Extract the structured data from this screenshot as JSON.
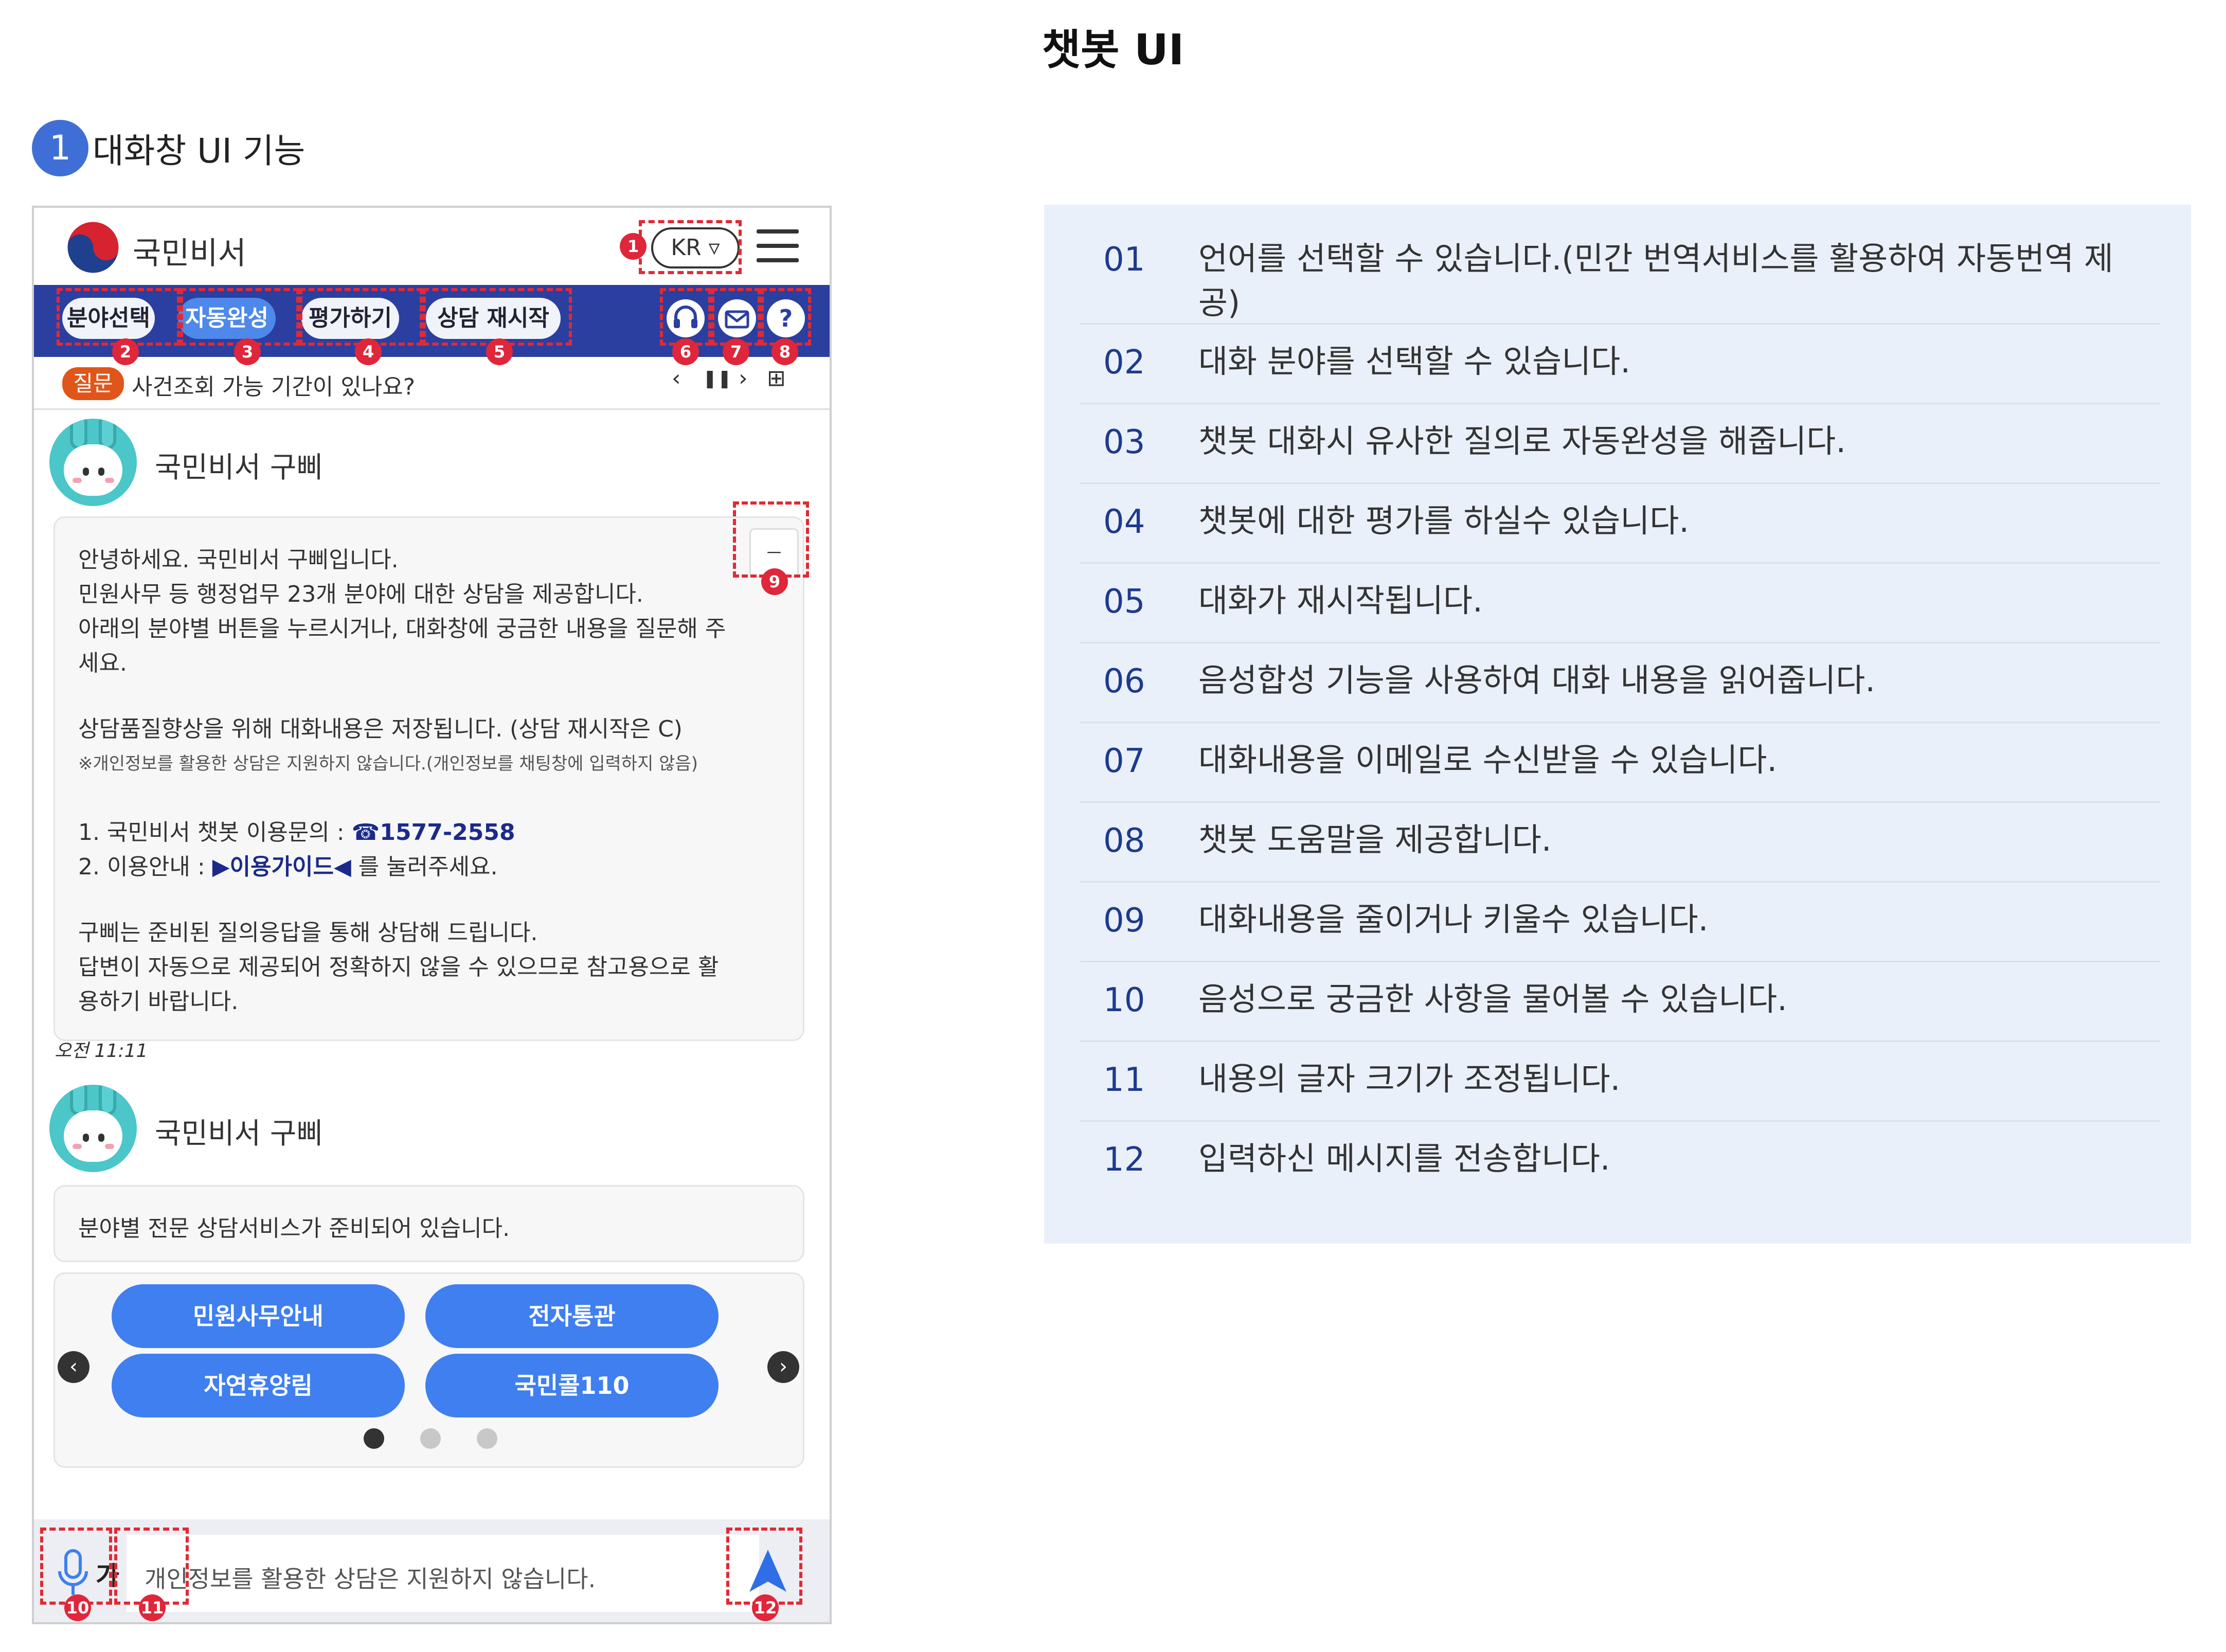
{
  "page_title": "챗봇 UI",
  "section": {
    "number": "1",
    "title": "대화창 UI 기능"
  },
  "phone": {
    "app_name": "국민비서",
    "language_button": "KR",
    "toolbar": {
      "buttons": [
        "분야선택",
        "자동완성",
        "평가하기",
        "상담 재시작"
      ],
      "icons": [
        "headset-icon",
        "mail-icon",
        "help-icon"
      ],
      "help_glyph": "?"
    },
    "question": {
      "tag": "질문",
      "text": "사건조회 가능 기간이 있나요?",
      "controls": [
        "‹",
        "❚❚",
        "›",
        "⊞"
      ]
    },
    "bot_name": "국민비서 구삐",
    "message1": {
      "lines": [
        "안녕하세요. 국민비서 구삐입니다.",
        "민원사무 등 행정업무 23개 분야에 대한 상담을 제공합니다.",
        "아래의 분야별 버튼을 누르시거나, 대화창에 궁금한 내용을 질문해 주",
        "세요.",
        "상담품질향상을 위해 대화내용은 저장됩니다. (상담 재시작은 C)",
        "※개인정보를 활용한 상담은 지원하지 않습니다.(개인정보를 채팅창에 입력하지 않음)",
        "1. 국민비서 챗봇 이용문의 :",
        "☎1577-2558",
        "2. 이용안내 :",
        "▶이용가이드◀",
        "를 눌러주세요.",
        "구삐는 준비된 질의응답을 통해 상담해 드립니다.",
        "답변이 자동으로 제공되어 정확하지 않을 수 있으므로 참고용으로 활",
        "용하기 바랍니다."
      ],
      "collapse_glyph": "━━━"
    },
    "timestamp": "오전 11:11",
    "message2": {
      "text": "분야별 전문 상담서비스가 준비되어 있습니다."
    },
    "service_buttons": [
      "민원사무안내",
      "전자통관",
      "자연휴양림",
      "국민콜110"
    ],
    "carousel_prev": "‹",
    "carousel_next": "›",
    "font_size_button": "가",
    "input_placeholder": "개인정보를 활용한 상담은 지원하지 않습니다."
  },
  "callout_numbers": [
    "1",
    "2",
    "3",
    "4",
    "5",
    "6",
    "7",
    "8",
    "9",
    "10",
    "11",
    "12"
  ],
  "descriptions": [
    {
      "num": "01",
      "text": "언어를 선택할 수 있습니다.(민간 번역서비스를 활용하여 자동번역 제공)"
    },
    {
      "num": "02",
      "text": "대화 분야를 선택할 수 있습니다."
    },
    {
      "num": "03",
      "text": "챗봇 대화시 유사한 질의로 자동완성을 해줍니다."
    },
    {
      "num": "04",
      "text": "챗봇에 대한 평가를 하실수 있습니다."
    },
    {
      "num": "05",
      "text": "대화가 재시작됩니다."
    },
    {
      "num": "06",
      "text": "음성합성 기능을 사용하여 대화 내용을 읽어줍니다."
    },
    {
      "num": "07",
      "text": "대화내용을 이메일로 수신받을 수 있습니다."
    },
    {
      "num": "08",
      "text": "챗봇 도움말을 제공합니다."
    },
    {
      "num": "09",
      "text": "대화내용을 줄이거나 키울수 있습니다."
    },
    {
      "num": "10",
      "text": "음성으로 궁금한 사항을 물어볼 수 있습니다."
    },
    {
      "num": "11",
      "text": "내용의 글자 크기가 조정됩니다."
    },
    {
      "num": "12",
      "text": "입력하신 메시지를 전송합니다."
    }
  ],
  "colors": {
    "toolbar": "#2b3fa0",
    "accent": "#3f7ff0",
    "callout": "#e02a35",
    "panel": "#eaf0f9"
  }
}
